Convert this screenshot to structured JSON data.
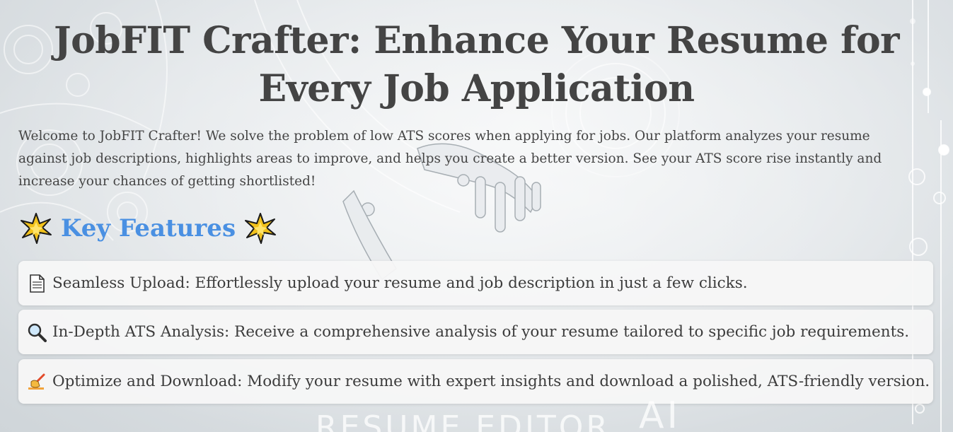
{
  "title": "JobFIT Crafter: Enhance Your Resume for Every Job Application",
  "intro": "Welcome to JobFIT Crafter! We solve the problem of low ATS scores when applying for jobs. Our platform analyzes your resume against job descriptions, highlights areas to improve, and helps you create a better version. See your ATS score rise instantly and increase your chances of getting shortlisted!",
  "features_heading": "Key Features",
  "features": [
    {
      "icon": "document-icon",
      "text": "Seamless Upload: Effortlessly upload your resume and job description in just a few clicks."
    },
    {
      "icon": "magnifier-icon",
      "text": "In-Depth ATS Analysis: Receive a comprehensive analysis of your resume tailored to specific job requirements."
    },
    {
      "icon": "writing-hand-icon",
      "text": "Optimize and Download: Modify your resume with expert insights and download a polished, ATS-friendly version."
    }
  ],
  "watermark": {
    "main": "RESUME EDITOR",
    "ai": "AI"
  },
  "colors": {
    "heading_accent": "#4a90e2",
    "title": "#444444",
    "card_bg": "#f7f6f6"
  }
}
